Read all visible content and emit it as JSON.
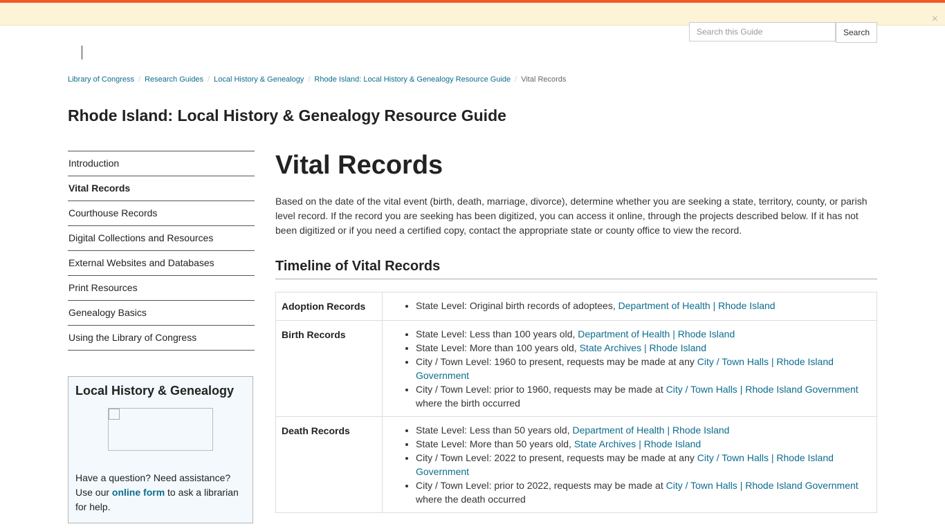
{
  "alert": {
    "close_icon": "×"
  },
  "search": {
    "placeholder": "Search this Guide",
    "button_label": "Search"
  },
  "breadcrumb": [
    "Library of Congress",
    "Research Guides",
    "Local History & Genealogy",
    "Rhode Island: Local History & Genealogy Resource Guide",
    "Vital Records"
  ],
  "guide_title": "Rhode Island: Local History & Genealogy Resource Guide",
  "sidebar": {
    "items": [
      {
        "label": "Introduction"
      },
      {
        "label": "Vital Records"
      },
      {
        "label": "Courthouse Records"
      },
      {
        "label": "Digital Collections and Resources"
      },
      {
        "label": "External Websites and Databases"
      },
      {
        "label": "Print Resources"
      },
      {
        "label": "Genealogy Basics"
      },
      {
        "label": "Using the Library of Congress"
      }
    ],
    "active_index": 1
  },
  "help_box": {
    "title": "Local History & Genealogy",
    "text_before": "Have a question? Need assistance? Use our ",
    "link_text": "online form",
    "text_after": " to ask a librarian for help."
  },
  "main": {
    "heading": "Vital Records",
    "intro": "Based on the date of the vital event (birth, death, marriage, divorce), determine whether you are seeking a state, territory, county, or parish level record. If the record you are seeking has been digitized, you can access it online, through the projects described below. If it has not been digitized or if you need a certified copy, contact the appropriate state or county office to view the record.",
    "section_heading": "Timeline of Vital Records"
  },
  "records": [
    {
      "label": "Adoption Records",
      "items": [
        {
          "text": "State Level: Original birth records of adoptees, ",
          "link": "Department of Health | Rhode Island",
          "after": ""
        }
      ]
    },
    {
      "label": "Birth Records",
      "items": [
        {
          "text": "State Level: Less than 100 years old, ",
          "link": "Department of Health | Rhode Island",
          "after": ""
        },
        {
          "text": "State Level: More than 100 years old, ",
          "link": "State Archives | Rhode Island",
          "after": ""
        },
        {
          "text": "City / Town Level: 1960 to present, requests may be made at any ",
          "link": "City / Town Halls | Rhode Island Government",
          "after": ""
        },
        {
          "text": "City / Town Level: prior to 1960, requests may be made at ",
          "link": "City / Town Halls | Rhode Island Government",
          "after": " where the birth occurred"
        }
      ]
    },
    {
      "label": "Death Records",
      "items": [
        {
          "text": "State Level: Less than 50 years old, ",
          "link": "Department of Health | Rhode Island",
          "after": ""
        },
        {
          "text": "State Level: More than 50 years old, ",
          "link": "State Archives | Rhode Island",
          "after": ""
        },
        {
          "text": "City / Town Level: 2022 to present, requests may be made at any ",
          "link": "City / Town Halls | Rhode Island Government",
          "after": ""
        },
        {
          "text": "City / Town Level: prior to 2022, requests may be made at ",
          "link": "City / Town Halls | Rhode Island Government",
          "after": " where the death occurred"
        }
      ]
    }
  ]
}
